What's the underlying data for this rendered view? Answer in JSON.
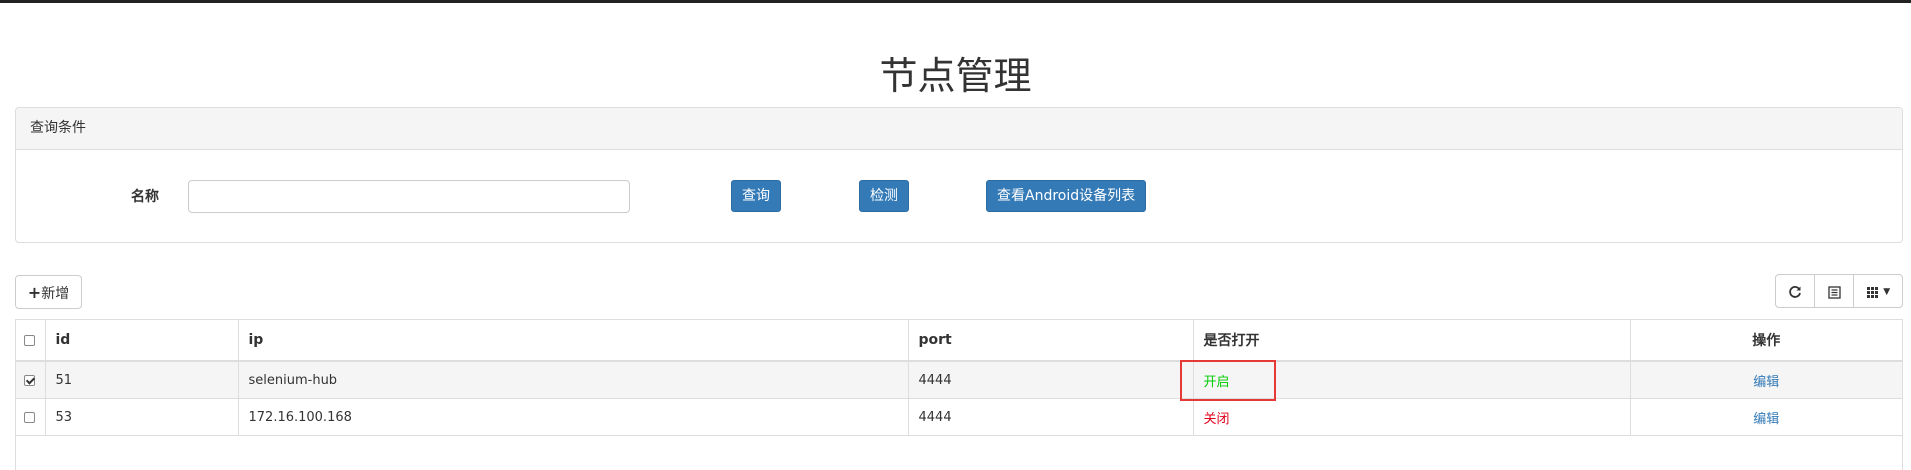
{
  "page": {
    "title": "节点管理"
  },
  "query_panel": {
    "heading": "查询条件",
    "name_label": "名称",
    "name_value": "",
    "name_placeholder": "",
    "search_label": "查询",
    "check_label": "检测",
    "android_list_label": "查看Android设备列表"
  },
  "toolbar": {
    "add_label": "新增",
    "refresh_icon": "refresh-icon",
    "toggle_view_icon": "list-icon",
    "columns_icon": "grid-icon"
  },
  "table": {
    "columns": [
      "id",
      "ip",
      "port",
      "是否打开",
      "操作"
    ],
    "rows": [
      {
        "checked": true,
        "id": "51",
        "ip": "selenium-hub",
        "port": "4444",
        "status": "开启",
        "action": "编辑"
      },
      {
        "checked": false,
        "id": "53",
        "ip": "172.16.100.168",
        "port": "4444",
        "status": "关闭",
        "action": "编辑"
      }
    ]
  },
  "colors": {
    "primary": "#337ab7",
    "status_on": "#00cc00",
    "status_off": "#e0001a",
    "highlight_box": "#e53935"
  }
}
